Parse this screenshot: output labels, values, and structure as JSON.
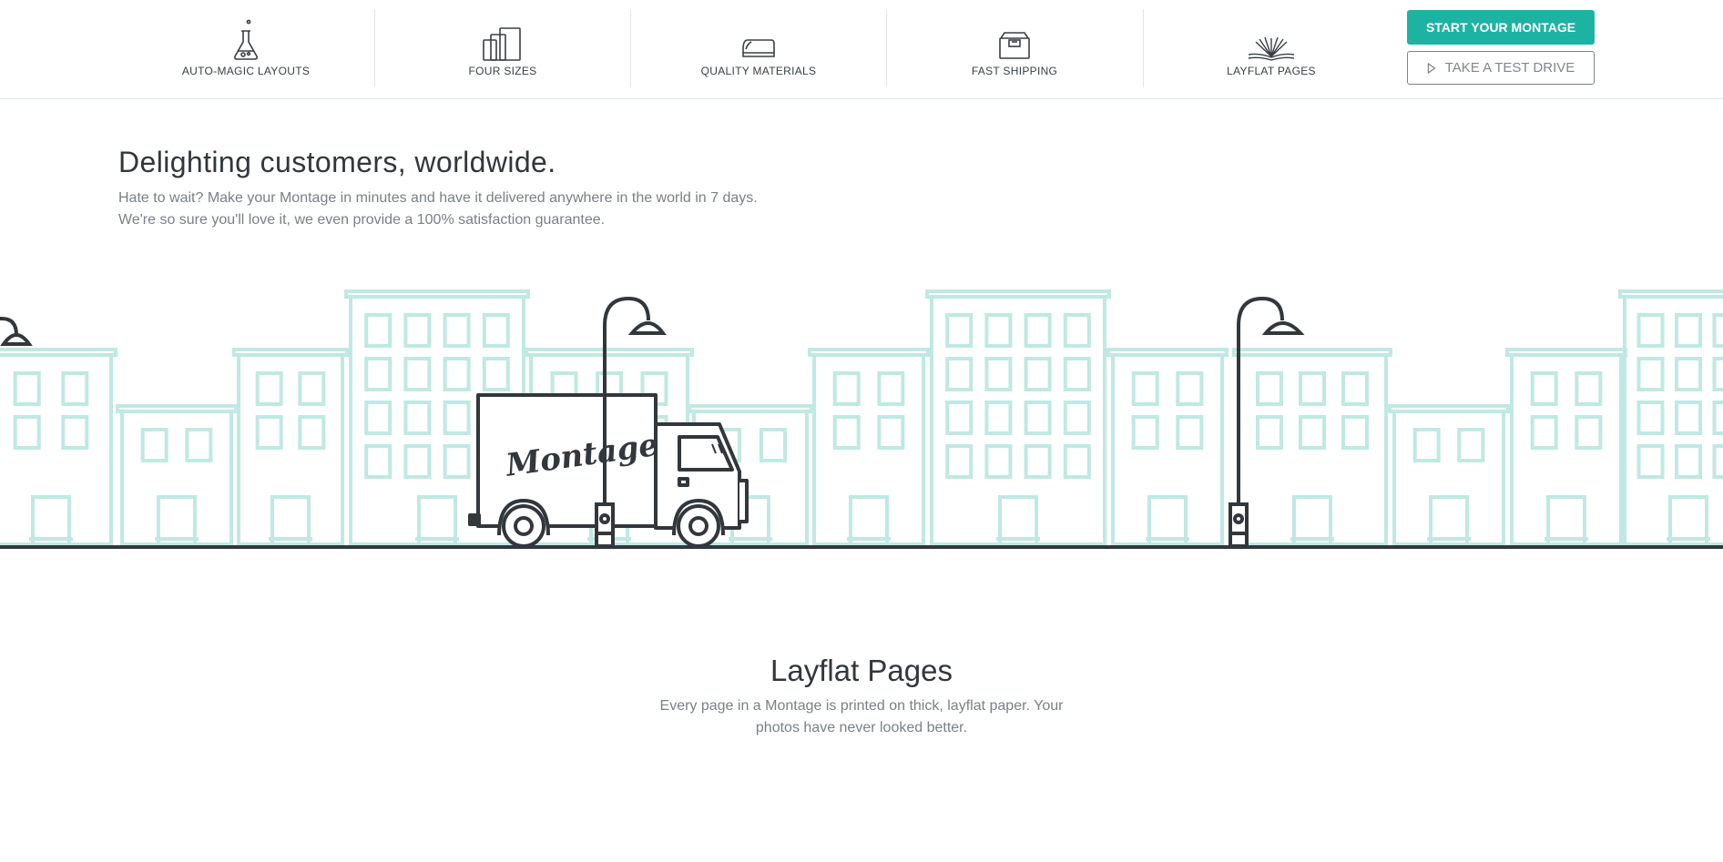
{
  "nav": {
    "features": [
      {
        "label": "AUTO-MAGIC LAYOUTS",
        "icon": "flask-icon"
      },
      {
        "label": "FOUR SIZES",
        "icon": "book-sizes-icon"
      },
      {
        "label": "QUALITY MATERIALS",
        "icon": "book-cover-icon"
      },
      {
        "label": "FAST SHIPPING",
        "icon": "shipping-box-icon"
      },
      {
        "label": "LAYFLAT PAGES",
        "icon": "open-book-icon"
      }
    ],
    "start_label": "START YOUR MONTAGE",
    "test_drive_label": "TAKE A TEST DRIVE"
  },
  "hero": {
    "title": "Delighting customers, worldwide.",
    "line1": "Hate to wait? Make your Montage in minutes and have it delivered anywhere in the world in 7 days.",
    "line2": "We're so sure you'll love it, we even provide a 100% satisfaction guarantee."
  },
  "illustration": {
    "truck_text": "Montage"
  },
  "layflat": {
    "title": "Layflat Pages",
    "line1": "Every page in a Montage is printed on thick, layflat paper. Your",
    "line2": "photos have never looked better."
  },
  "colors": {
    "accent": "#1db3a3",
    "buildings": "#bfe9e2",
    "ink": "#32373c",
    "muted_text": "#7a8085"
  }
}
